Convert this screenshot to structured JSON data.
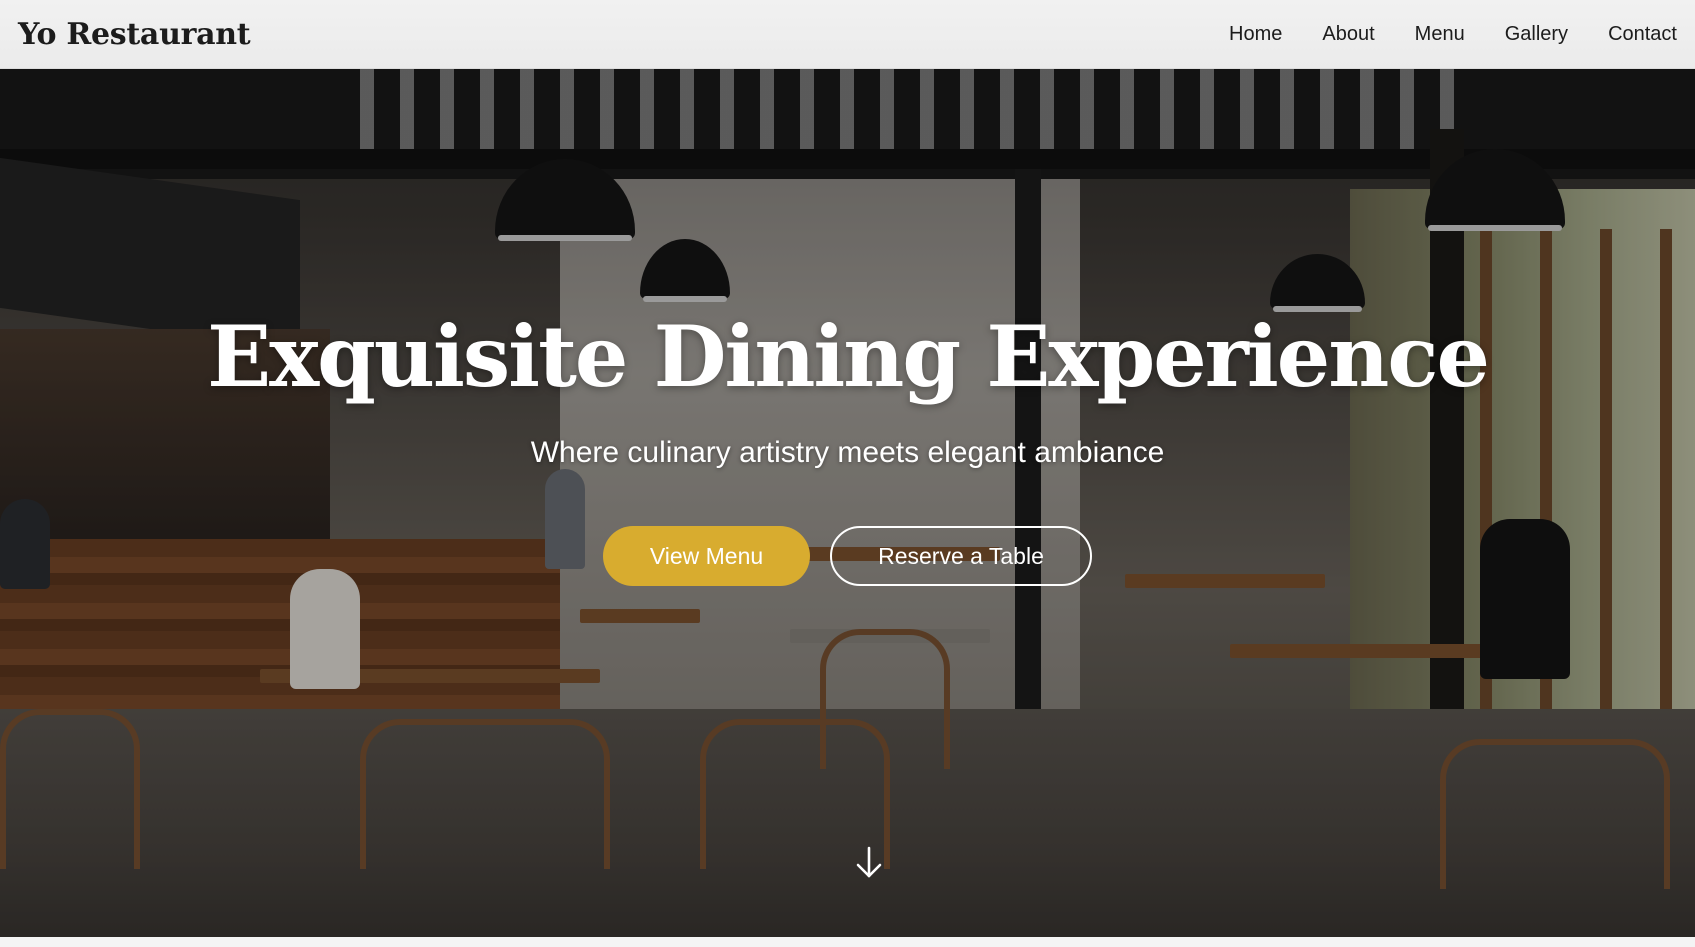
{
  "navbar": {
    "brand": "Yo Restaurant",
    "links": [
      "Home",
      "About",
      "Menu",
      "Gallery",
      "Contact"
    ]
  },
  "hero": {
    "title": "Exquisite Dining Experience",
    "subtitle": "Where culinary artistry meets elegant ambiance",
    "primary_button": "View Menu",
    "secondary_button": "Reserve a Table",
    "scroll_icon": "arrow-down-icon",
    "background_image": "restaurant-interior-photo"
  },
  "colors": {
    "accent": "#d8ac2f",
    "navbar_bg": "#efefef",
    "text_dark": "#1c1c1c",
    "text_light": "#ffffff"
  }
}
